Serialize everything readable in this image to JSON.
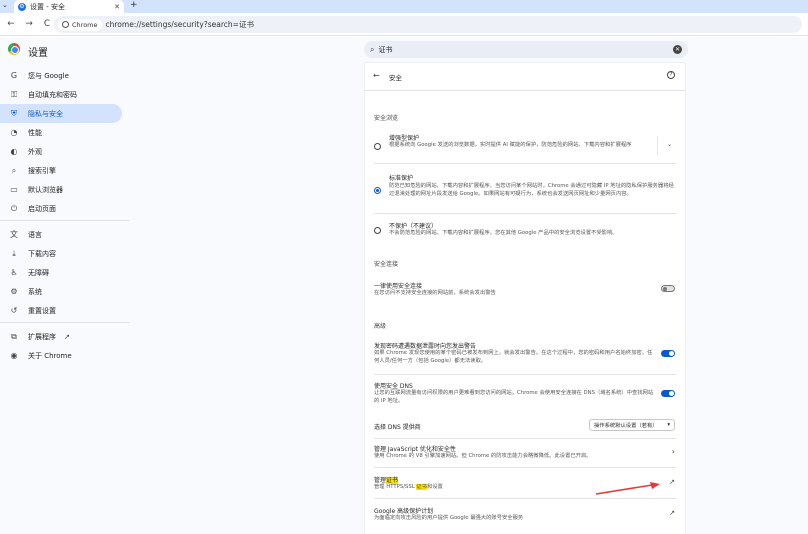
{
  "tab": {
    "title": "设置 - 安全",
    "new_tab": "+"
  },
  "toolbar": {
    "back": "←",
    "forward": "→",
    "reload": "C",
    "chip": "Chrome",
    "url": "chrome://settings/security?search=证书"
  },
  "header": {
    "title": "设置",
    "search_value": "证书"
  },
  "sidebar": {
    "items": [
      {
        "label": "您与 Google",
        "icon": "G"
      },
      {
        "label": "自动填充和密码",
        "icon": "⚿"
      },
      {
        "label": "隐私与安全",
        "icon": "⛨"
      },
      {
        "label": "性能",
        "icon": "◔"
      },
      {
        "label": "外观",
        "icon": "◐"
      },
      {
        "label": "搜索引擎",
        "icon": "⌕"
      },
      {
        "label": "默认浏览器",
        "icon": "▭"
      },
      {
        "label": "启动页面",
        "icon": "⏻"
      },
      {
        "label": "语言",
        "icon": "文"
      },
      {
        "label": "下载内容",
        "icon": "⤓"
      },
      {
        "label": "无障碍",
        "icon": "♿"
      },
      {
        "label": "系统",
        "icon": "⚙"
      },
      {
        "label": "重置设置",
        "icon": "↺"
      },
      {
        "label": "扩展程序",
        "icon": "⧉",
        "ext": "↗"
      },
      {
        "label": "关于 Chrome",
        "icon": "◉"
      }
    ]
  },
  "card": {
    "title": "安全",
    "section_safe_browsing": "安全浏览",
    "enhanced": {
      "title": "增强型保护",
      "desc": "根据系统向 Google 发送的浏览数据，实时提供 AI 赋能的保护，防范危险的网站、下载内容和扩展程序"
    },
    "standard": {
      "title": "标准保护",
      "desc": "防范已知危险的网站、下载内容和扩展程序。当您访问某个网站时，Chrome 会通过可隐藏 IP 地址的隐私保护服务器将经过混淆处理的网址片段发送给 Google。如果网站有可疑行为，系统也会发送网页网址和少量网页内容。"
    },
    "noprotect": {
      "title": "不保护（不建议）",
      "desc": "不会防范危险的网站、下载内容和扩展程序。您在其他 Google 产品中的安全浏览设置不受影响。"
    },
    "section_secure_conn": "安全连接",
    "always_secure": {
      "title": "一律使用安全连接",
      "desc": "在您访问不支持安全连接的网站前，系统会发出警告"
    },
    "section_advanced": "高级",
    "password_leak": {
      "title": "发现密码遭遇数据泄露时向您发出警告",
      "desc": "如果 Chrome 发现您使用的某个密码已被发布到网上，就会发出警告。在这个过程中，您的密码和用户名始终加密，任何人员/任何一方（包括 Google）都无法读取。"
    },
    "secure_dns": {
      "title": "使用安全 DNS",
      "desc": "让您的互联网流量有访问权限的用户更难看到您访问的网站。Chrome 会使用安全连接在 DNS（域名系统）中查找网站的 IP 地址。"
    },
    "dns_provider": {
      "label": "选择 DNS 提供商",
      "select": "操作系统默认设置（若有）"
    },
    "js_optimize": {
      "title": "管理 JavaScript 优化和安全性",
      "desc": "使用 Chrome 的 V8 引擎加速网站。但 Chrome 的防攻击能力会略微降低。此设置已开启。"
    },
    "certs": {
      "title_a": "管理",
      "title_hl": "证书",
      "desc_a": "管理 HTTPS/SSL ",
      "desc_hl": "证书",
      "desc_b": "和设置"
    },
    "advanced_protection": {
      "title": "Google 高级保护计划",
      "desc": "为面临定向攻击风险的用户提供 Google 最强大的账号安全服务"
    }
  },
  "colors": {
    "accent": "#0b57d0",
    "annotation_arrow": "#e53935"
  }
}
